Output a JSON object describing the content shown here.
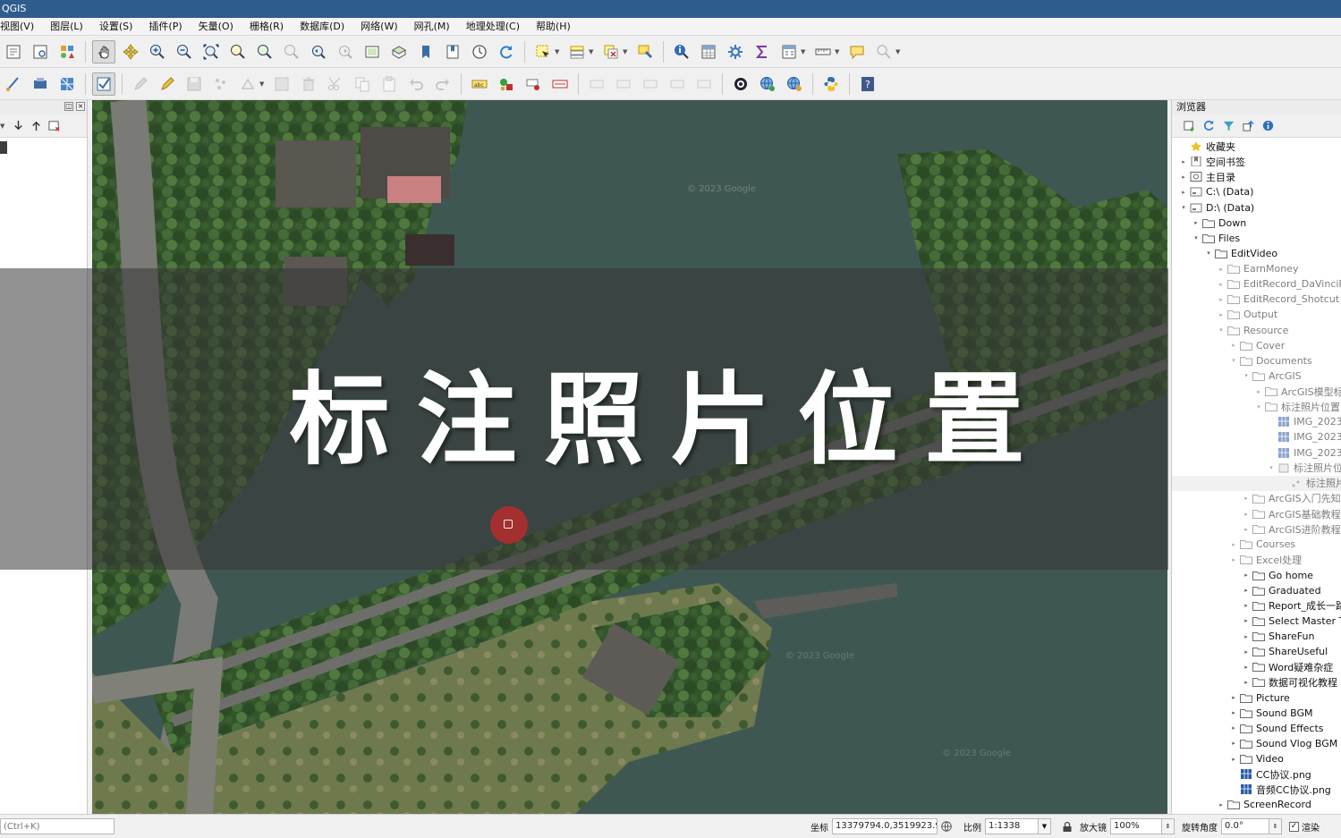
{
  "window": {
    "title": "QGIS"
  },
  "menu": [
    {
      "label": "视图(V)"
    },
    {
      "label": "图层(L)"
    },
    {
      "label": "设置(S)"
    },
    {
      "label": "插件(P)"
    },
    {
      "label": "矢量(O)"
    },
    {
      "label": "栅格(R)"
    },
    {
      "label": "数据库(D)"
    },
    {
      "label": "网络(W)"
    },
    {
      "label": "网孔(M)"
    },
    {
      "label": "地理处理(C)"
    },
    {
      "label": "帮助(H)"
    }
  ],
  "overlay": {
    "title": "标注照片位置"
  },
  "map": {
    "watermark": "© 2023 Google"
  },
  "browser": {
    "title": "浏览器",
    "items": [
      {
        "label": "收藏夹",
        "icon": "star-icon",
        "twisty": ""
      },
      {
        "label": "空间书签",
        "icon": "bookmark-icon",
        "twisty": "▸"
      },
      {
        "label": "主目录",
        "icon": "home-icon",
        "twisty": "▸"
      },
      {
        "label": "C:\\ (Data)",
        "icon": "drive-icon",
        "twisty": "▸"
      },
      {
        "label": "D:\\ (Data)",
        "icon": "drive-icon",
        "twisty": "▾"
      },
      {
        "label": "Down",
        "icon": "folder-icon",
        "twisty": "▸"
      },
      {
        "label": "Files",
        "icon": "folder-icon",
        "twisty": "▾"
      },
      {
        "label": "EditVideo",
        "icon": "folder-icon",
        "twisty": "▾"
      },
      {
        "label": "EarnMoney",
        "icon": "folder-icon",
        "twisty": "▸"
      },
      {
        "label": "EditRecord_DaVinciR",
        "icon": "folder-icon",
        "twisty": "▸"
      },
      {
        "label": "EditRecord_Shotcut",
        "icon": "folder-icon",
        "twisty": "▸"
      },
      {
        "label": "Output",
        "icon": "folder-icon",
        "twisty": "▸"
      },
      {
        "label": "Resource",
        "icon": "folder-icon",
        "twisty": "▾"
      },
      {
        "label": "Cover",
        "icon": "folder-icon",
        "twisty": "▸"
      },
      {
        "label": "Documents",
        "icon": "folder-icon",
        "twisty": "▾"
      },
      {
        "label": "ArcGIS",
        "icon": "folder-icon",
        "twisty": "▾"
      },
      {
        "label": "ArcGIS模型标",
        "icon": "folder-icon",
        "twisty": "▸"
      },
      {
        "label": "标注照片位置",
        "icon": "folder-icon",
        "twisty": "▾"
      },
      {
        "label": "IMG_2023",
        "icon": "raster-icon",
        "twisty": ""
      },
      {
        "label": "IMG_2023",
        "icon": "raster-icon",
        "twisty": ""
      },
      {
        "label": "IMG_2023",
        "icon": "raster-icon",
        "twisty": ""
      },
      {
        "label": "标注照片位",
        "icon": "geopackage-icon",
        "twisty": "▾"
      },
      {
        "label": "标注照片",
        "icon": "point-layer-icon",
        "twisty": ""
      },
      {
        "label": "ArcGIS入门先知",
        "icon": "folder-icon",
        "twisty": "▸"
      },
      {
        "label": "ArcGIS基础教程",
        "icon": "folder-icon",
        "twisty": "▸"
      },
      {
        "label": "ArcGIS进阶教程",
        "icon": "folder-icon",
        "twisty": "▸"
      },
      {
        "label": "Courses",
        "icon": "folder-icon",
        "twisty": "▸"
      },
      {
        "label": "Excel处理",
        "icon": "folder-icon",
        "twisty": "▸"
      },
      {
        "label": "Go home",
        "icon": "folder-icon",
        "twisty": "▸"
      },
      {
        "label": "Graduated",
        "icon": "folder-icon",
        "twisty": "▸"
      },
      {
        "label": "Report_成长一路",
        "icon": "folder-icon",
        "twisty": "▸"
      },
      {
        "label": "Select Master T",
        "icon": "folder-icon",
        "twisty": "▸"
      },
      {
        "label": "ShareFun",
        "icon": "folder-icon",
        "twisty": "▸"
      },
      {
        "label": "ShareUseful",
        "icon": "folder-icon",
        "twisty": "▸"
      },
      {
        "label": "Word疑难杂症",
        "icon": "folder-icon",
        "twisty": "▸"
      },
      {
        "label": "数据可视化教程",
        "icon": "folder-icon",
        "twisty": "▸"
      },
      {
        "label": "Picture",
        "icon": "folder-icon",
        "twisty": "▸"
      },
      {
        "label": "Sound BGM",
        "icon": "folder-icon",
        "twisty": "▸"
      },
      {
        "label": "Sound Effects",
        "icon": "folder-icon",
        "twisty": "▸"
      },
      {
        "label": "Sound Vlog BGM",
        "icon": "folder-icon",
        "twisty": "▸"
      },
      {
        "label": "Video",
        "icon": "folder-icon",
        "twisty": "▸"
      },
      {
        "label": "CC协议.png",
        "icon": "raster-icon",
        "twisty": ""
      },
      {
        "label": "音频CC协议.png",
        "icon": "raster-icon",
        "twisty": ""
      },
      {
        "label": "ScreenRecord",
        "icon": "folder-icon",
        "twisty": "▸"
      }
    ]
  },
  "status": {
    "locator_placeholder": "(Ctrl+K)",
    "coord_label": "坐标",
    "coord_value": "13379794.0,3519923.9",
    "scale_label": "比例",
    "scale_value": "1:1338",
    "magnifier_label": "放大镜",
    "magnifier_value": "100%",
    "rotation_label": "旋转角度",
    "rotation_value": "0.0°",
    "render_label": "渲染",
    "render_check": "✓"
  }
}
